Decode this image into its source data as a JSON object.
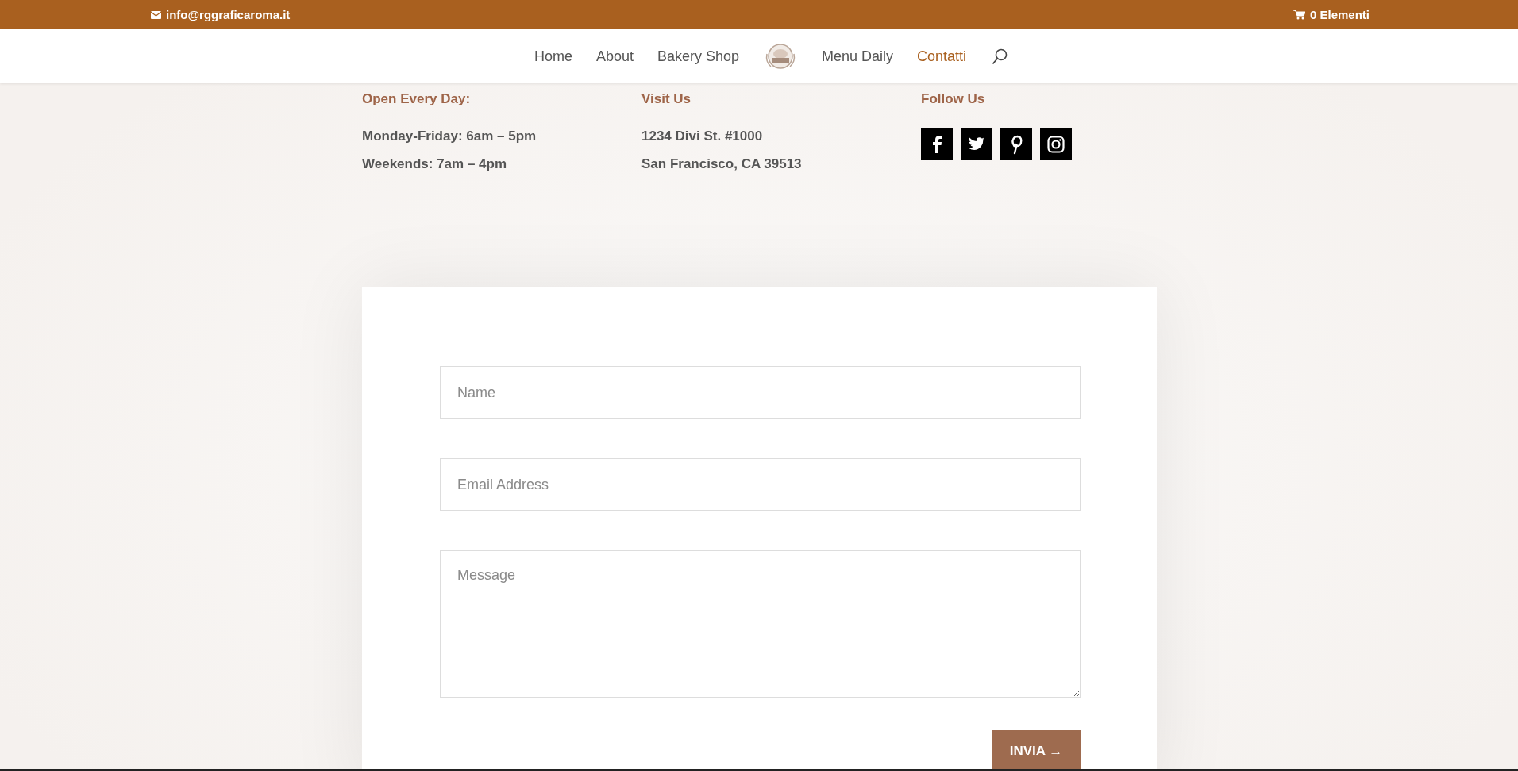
{
  "top_bar": {
    "email": "info@rggraficaroma.it",
    "cart": "0 Elementi"
  },
  "nav": {
    "items": [
      {
        "label": "Home",
        "selected": false
      },
      {
        "label": "About",
        "selected": false
      },
      {
        "label": "Bakery Shop",
        "selected": false
      },
      {
        "kind": "logo"
      },
      {
        "label": "Menu Daily",
        "selected": false
      },
      {
        "label": "Contatti",
        "selected": true
      }
    ]
  },
  "info": [
    {
      "heading": "Open Every Day:",
      "lines": [
        "Monday-Friday: 6am – 5pm",
        "Weekends: 7am – 4pm"
      ]
    },
    {
      "heading": "Visit Us",
      "lines": [
        "1234 Divi St. #1000",
        "San Francisco, CA 39513"
      ]
    },
    {
      "heading": "Follow Us",
      "social": [
        {
          "kind": "facebook"
        },
        {
          "kind": "twitter"
        },
        {
          "kind": "pinterest"
        },
        {
          "kind": "instagram"
        }
      ]
    }
  ],
  "form": {
    "fields": [
      {
        "kind": "input",
        "placeholder": "Name"
      },
      {
        "kind": "input",
        "placeholder": "Email Address"
      },
      {
        "kind": "textarea",
        "placeholder": "Message"
      }
    ],
    "submit": {
      "label": "INVIA",
      "arrow": "→"
    }
  }
}
